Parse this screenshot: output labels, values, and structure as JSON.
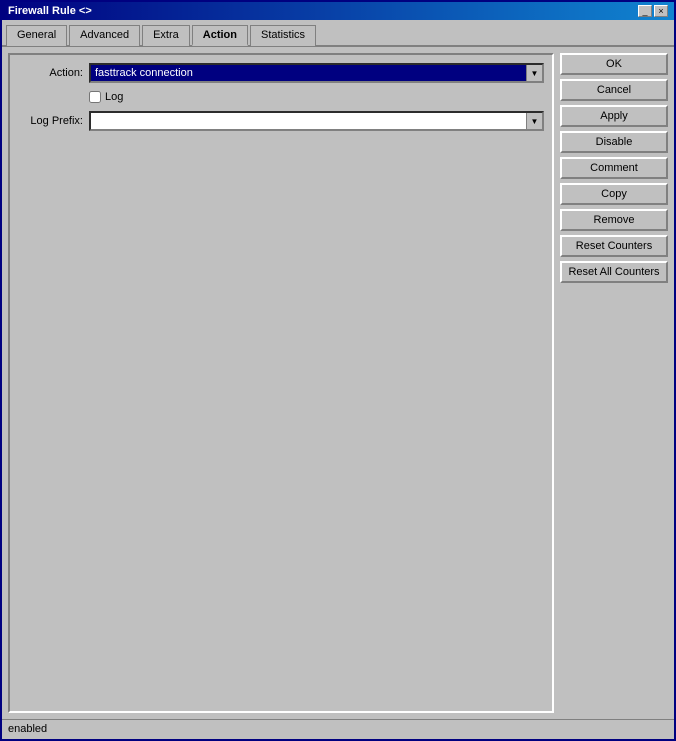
{
  "titleBar": {
    "title": "Firewall Rule <>",
    "minimizeBtn": "_",
    "closeBtn": "×"
  },
  "tabs": [
    {
      "id": "general",
      "label": "General",
      "active": false
    },
    {
      "id": "advanced",
      "label": "Advanced",
      "active": false
    },
    {
      "id": "extra",
      "label": "Extra",
      "active": false
    },
    {
      "id": "action",
      "label": "Action",
      "active": true
    },
    {
      "id": "statistics",
      "label": "Statistics",
      "active": false
    }
  ],
  "form": {
    "actionLabel": "Action:",
    "actionValue": "fasttrack connection",
    "actionArrow": "▼",
    "logCheckboxLabel": "Log",
    "logPrefixLabel": "Log Prefix:",
    "logPrefixValue": "",
    "logPrefixArrow": "▼"
  },
  "buttons": {
    "ok": "OK",
    "cancel": "Cancel",
    "apply": "Apply",
    "disable": "Disable",
    "comment": "Comment",
    "copy": "Copy",
    "remove": "Remove",
    "resetCounters": "Reset Counters",
    "resetAllCounters": "Reset All Counters"
  },
  "statusBar": {
    "text": "enabled"
  }
}
